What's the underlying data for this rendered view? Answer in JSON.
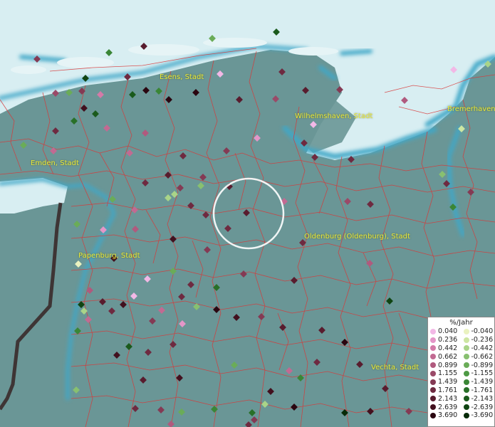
{
  "map": {
    "colors": {
      "land": "#6a9696",
      "sea": "#d8eef2",
      "coast_water": "#3fa7c7",
      "boundaries": "#d83838",
      "selection_ring": "#ffffff"
    }
  },
  "cities": [
    {
      "name": "Esens, Stadt"
    },
    {
      "name": "Wilhelmshaven, Stadt"
    },
    {
      "name": "Bremerhaven"
    },
    {
      "name": "Emden, Stadt"
    },
    {
      "name": "Oldenburg (Oldenburg), Stadt"
    },
    {
      "name": "Papenburg, Stadt"
    },
    {
      "name": "Vechta, Stadt"
    }
  ],
  "legend": {
    "title": "%/Jahr",
    "positive": [
      {
        "label": "0.040",
        "color": "#f2b8e6"
      },
      {
        "label": "0.236",
        "color": "#e496c8"
      },
      {
        "label": "0.442",
        "color": "#d47aa8"
      },
      {
        "label": "0.662",
        "color": "#c26a92"
      },
      {
        "label": "0.899",
        "color": "#b05a7e"
      },
      {
        "label": "1.155",
        "color": "#9a4a68"
      },
      {
        "label": "1.439",
        "color": "#843a54"
      },
      {
        "label": "1.761",
        "color": "#6e2a40"
      },
      {
        "label": "2.143",
        "color": "#581c2e"
      },
      {
        "label": "2.639",
        "color": "#42101e"
      },
      {
        "label": "3.690",
        "color": "#2a0610"
      }
    ],
    "negative": [
      {
        "label": "-0.040",
        "color": "#eaf2c0"
      },
      {
        "label": "-0.236",
        "color": "#cde6a2"
      },
      {
        "label": "-0.442",
        "color": "#a9d488"
      },
      {
        "label": "-0.662",
        "color": "#88c070"
      },
      {
        "label": "-0.899",
        "color": "#6aac58"
      },
      {
        "label": "-1.155",
        "color": "#4e9a44"
      },
      {
        "label": "-1.439",
        "color": "#3a8636"
      },
      {
        "label": "-1.761",
        "color": "#287028"
      },
      {
        "label": "-2.143",
        "color": "#1a5a1c"
      },
      {
        "label": "-2.639",
        "color": "#0f4412"
      },
      {
        "label": "-3.690",
        "color": "#062a08"
      }
    ]
  }
}
